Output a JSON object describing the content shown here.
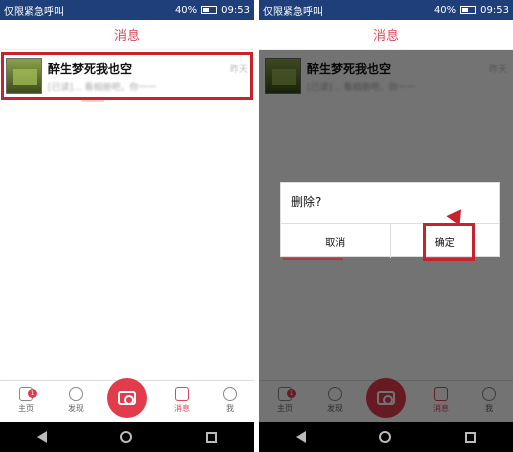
{
  "status": {
    "left_text": "仅限紧急呼叫",
    "battery_text": "40%",
    "time": "09:53"
  },
  "header": {
    "title": "消息"
  },
  "conversation": {
    "name": "醉生梦死我也空",
    "preview": "[已读]... 看相册吧，你一一",
    "time": "昨天"
  },
  "dialog": {
    "title": "删除?",
    "cancel_label": "取消",
    "confirm_label": "确定"
  },
  "tabbar": {
    "home": "主页",
    "home_badge": "1",
    "discover": "发现",
    "messages": "消息",
    "me": "我"
  },
  "colors": {
    "accent": "#d9485a",
    "highlight": "#c8232c",
    "statusbar": "#1f3f7a"
  },
  "icons": {
    "home": "home-icon",
    "discover": "search-icon",
    "camera": "camera-icon",
    "messages": "chat-icon",
    "me": "user-icon"
  }
}
